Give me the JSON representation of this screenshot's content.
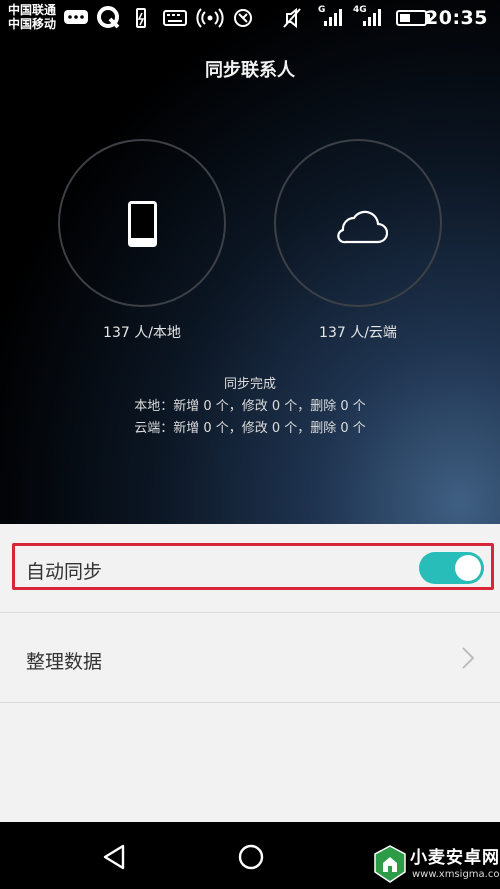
{
  "status_bar": {
    "carrier_1": "中国联通",
    "carrier_2": "中国移动",
    "net_label_1": "G",
    "net_label_2": "4G",
    "time": "20:35",
    "battery_level": 0.45
  },
  "header": {
    "title": "同步联系人"
  },
  "summary": {
    "local_count": "137 人/本地",
    "cloud_count": "137 人/云端",
    "sync_status": "同步完成",
    "local_detail": "本地：新增 0 个，修改 0 个，删除 0 个",
    "cloud_detail": "云端：新增 0 个，修改 0 个，删除 0 个"
  },
  "settings": {
    "auto_sync_label": "自动同步",
    "auto_sync_on": true,
    "organize_label": "整理数据"
  },
  "watermark": {
    "title": "小麦安卓网",
    "url": "www.xmsigma.com"
  },
  "colors": {
    "toggle_on": "#28bdb8",
    "highlight": "#d72638"
  },
  "icons": {
    "phone": "phone-icon",
    "cloud": "cloud-icon",
    "back": "back-triangle-icon",
    "home": "home-circle-icon"
  }
}
